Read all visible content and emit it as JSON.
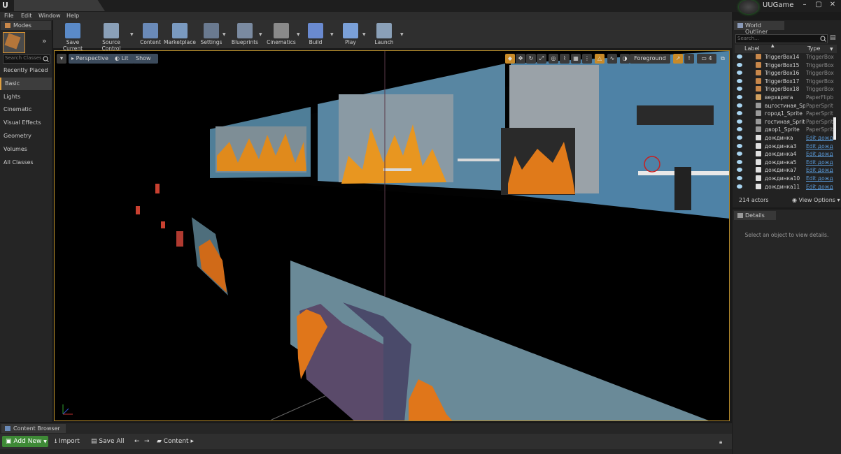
{
  "window": {
    "doc_tab": "",
    "project_name": "UUGame",
    "controls": [
      "–",
      "▢",
      "✕"
    ]
  },
  "menubar": [
    "File",
    "Edit",
    "Window",
    "Help"
  ],
  "modes_panel": {
    "tab_label": "Modes",
    "search_placeholder": "Search Classes",
    "categories": [
      "Recently Placed",
      "Basic",
      "Lights",
      "Cinematic",
      "Visual Effects",
      "Geometry",
      "Volumes",
      "All Classes"
    ],
    "active_category": "Basic"
  },
  "toolbar": {
    "buttons": [
      {
        "label": "Save Current",
        "color": "#5a8ac8"
      },
      {
        "label": "Source Control",
        "color": "#8aa0b8"
      },
      {
        "label": "Content",
        "color": "#6a8ab8"
      },
      {
        "label": "Marketplace",
        "color": "#7a9ac0"
      },
      {
        "label": "Settings",
        "color": "#6a7a90"
      },
      {
        "label": "Blueprints",
        "color": "#7a8aa0"
      },
      {
        "label": "Cinematics",
        "color": "#8a8a8a"
      },
      {
        "label": "Build",
        "color": "#6a8ad0"
      },
      {
        "label": "Play",
        "color": "#7aa0d8"
      },
      {
        "label": "Launch",
        "color": "#8aa0b8"
      }
    ]
  },
  "viewport": {
    "view_mode": "Perspective",
    "lighting": "Lit",
    "show": "Show",
    "layer": "Foreground",
    "camera_speed": "4"
  },
  "outliner": {
    "tab_label": "World Outliner",
    "search_placeholder": "Search...",
    "col_label": "Label",
    "col_type": "Type",
    "rows": [
      {
        "label": "TriggerBox14",
        "type": "TriggerBox",
        "link": false,
        "icon_color": "#c8874a"
      },
      {
        "label": "TriggerBox15",
        "type": "TriggerBox",
        "link": false,
        "icon_color": "#c8874a"
      },
      {
        "label": "TriggerBox16",
        "type": "TriggerBox",
        "link": false,
        "icon_color": "#c8874a"
      },
      {
        "label": "TriggerBox17",
        "type": "TriggerBox",
        "link": false,
        "icon_color": "#c8874a"
      },
      {
        "label": "TriggerBox18",
        "type": "TriggerBox",
        "link": false,
        "icon_color": "#c8874a"
      },
      {
        "label": "верхвряга",
        "type": "PaperFlipb",
        "link": false,
        "icon_color": "#d0a060"
      },
      {
        "label": "вцгостиная_Sprite",
        "type": "PaperSprit",
        "link": false,
        "icon_color": "#9a9a9a"
      },
      {
        "label": "город1_Sprite",
        "type": "PaperSprit",
        "link": false,
        "icon_color": "#9a9a9a"
      },
      {
        "label": "гостиная_Sprite",
        "type": "PaperSprit",
        "link": false,
        "icon_color": "#9a9a9a"
      },
      {
        "label": "двор1_Sprite",
        "type": "PaperSprit",
        "link": false,
        "icon_color": "#9a9a9a"
      },
      {
        "label": "дождинка",
        "type": "Edit дожд",
        "link": true,
        "icon_color": "#e0e0e0"
      },
      {
        "label": "дождинка3",
        "type": "Edit дожд",
        "link": true,
        "icon_color": "#e0e0e0"
      },
      {
        "label": "дождинка4",
        "type": "Edit дожд",
        "link": true,
        "icon_color": "#e0e0e0"
      },
      {
        "label": "дождинка5",
        "type": "Edit дожд",
        "link": true,
        "icon_color": "#e0e0e0"
      },
      {
        "label": "дождинка7",
        "type": "Edit дожд",
        "link": true,
        "icon_color": "#e0e0e0"
      },
      {
        "label": "дождинка10",
        "type": "Edit дожд",
        "link": true,
        "icon_color": "#e0e0e0"
      },
      {
        "label": "дождинка11",
        "type": "Edit дожд",
        "link": true,
        "icon_color": "#e0e0e0"
      }
    ],
    "actor_count": "214 actors",
    "view_options": "View Options"
  },
  "details": {
    "tab_label": "Details",
    "hint": "Select an object to view details."
  },
  "content_browser": {
    "tab_label": "Content Browser",
    "add_new": "Add New",
    "import": "Import",
    "save_all": "Save All",
    "path": "Content"
  }
}
